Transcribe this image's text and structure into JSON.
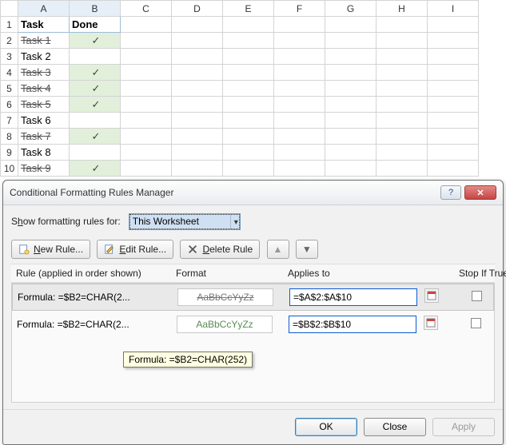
{
  "columns": [
    "A",
    "B",
    "C",
    "D",
    "E",
    "F",
    "G",
    "H",
    "I"
  ],
  "row_numbers": [
    "1",
    "2",
    "3",
    "4",
    "5",
    "6",
    "7",
    "8",
    "9",
    "10"
  ],
  "headers": {
    "a": "Task",
    "b": "Done"
  },
  "tasks": [
    {
      "name": "Task 1",
      "done": "✓",
      "strike": true
    },
    {
      "name": "Task 2",
      "done": "",
      "strike": false
    },
    {
      "name": "Task 3",
      "done": "✓",
      "strike": true
    },
    {
      "name": "Task 4",
      "done": "✓",
      "strike": true
    },
    {
      "name": "Task 5",
      "done": "✓",
      "strike": true
    },
    {
      "name": "Task 6",
      "done": "",
      "strike": false
    },
    {
      "name": "Task 7",
      "done": "✓",
      "strike": true
    },
    {
      "name": "Task 8",
      "done": "",
      "strike": false
    },
    {
      "name": "Task 9",
      "done": "✓",
      "strike": true
    }
  ],
  "dialog": {
    "title": "Conditional Formatting Rules Manager",
    "show_label_pre": "S",
    "show_label_u": "h",
    "show_label_post": "ow formatting rules for:",
    "scope": "This Worksheet",
    "new_pre": "",
    "new_u": "N",
    "new_post": "ew Rule...",
    "edit_pre": "",
    "edit_u": "E",
    "edit_post": "dit Rule...",
    "del_pre": "",
    "del_u": "D",
    "del_post": "elete Rule",
    "hdr_rule": "Rule (applied in order shown)",
    "hdr_format": "Format",
    "hdr_applies": "Applies to",
    "hdr_stop": "Stop If True",
    "rules": [
      {
        "label": "Formula: =$B2=CHAR(2...",
        "preview": "AaBbCcYyZz",
        "applies": "=$A$2:$A$10",
        "style": "strike"
      },
      {
        "label": "Formula: =$B2=CHAR(2...",
        "preview": "AaBbCcYyZz",
        "applies": "=$B$2:$B$10",
        "style": "green"
      }
    ],
    "tooltip": "Formula: =$B2=CHAR(252)",
    "ok": "OK",
    "close": "Close",
    "apply": "Apply"
  }
}
